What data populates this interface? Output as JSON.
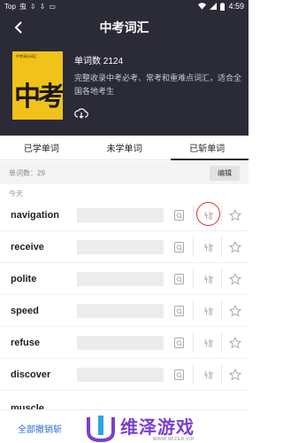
{
  "status_bar": {
    "left_items": [
      "Top",
      "虫",
      "⇩",
      "⇩",
      "▭"
    ],
    "time": "4:59"
  },
  "header": {
    "title": "中考词汇",
    "cover_small_text": "中考高分词汇",
    "cover_big_text": "中考",
    "word_count": "单词数 2124",
    "description": "完整收录中考必考、常考和重难点词汇，适合全国各地考生"
  },
  "tabs": [
    {
      "label": "已学单词",
      "active": false
    },
    {
      "label": "未学单词",
      "active": false
    },
    {
      "label": "已斩单词",
      "active": true
    }
  ],
  "sub_bar": {
    "count_text": "单词数：29",
    "edit_label": "编辑"
  },
  "section_label": "今天",
  "words": [
    {
      "word": "navigation"
    },
    {
      "word": "receive"
    },
    {
      "word": "polite"
    },
    {
      "word": "speed"
    },
    {
      "word": "refuse"
    },
    {
      "word": "discover"
    }
  ],
  "partial_word": "muscle",
  "bottom_bar": {
    "undo_all_label": "全部撤销斩"
  },
  "watermark": {
    "title": "维泽游戏",
    "subtitle": "WWW.WIZED.VIP"
  },
  "colors": {
    "header_bg": "#2b2b38",
    "cover_yellow": "#f1c21a",
    "accent_blue": "#2a6cd7",
    "watermark_purple": "#7b3fd2",
    "highlight_red": "#d03030"
  }
}
